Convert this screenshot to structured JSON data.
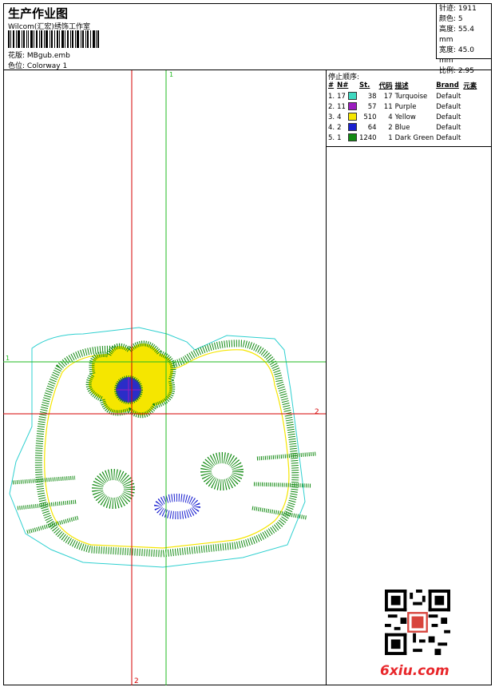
{
  "header": {
    "title": "生产作业图",
    "subtitle": "Wilcom(汇宏)绣饰工作室",
    "design_label": "花版:",
    "design_value": "MBgub.emb",
    "colorway_label": "色位:",
    "colorway_value": "Colorway 1"
  },
  "info": {
    "stitches_label": "针迹:",
    "stitches_value": "1911",
    "colors_label": "颜色:",
    "colors_value": "5",
    "height_label": "高度:",
    "height_value": "55.4 mm",
    "width_label": "宽度:",
    "width_value": "45.0 mm",
    "scale_label": "比例:",
    "scale_value": "2.95"
  },
  "stop_sequence": {
    "title": "停止顺序:",
    "columns": [
      "#",
      "N#",
      "St.",
      "代码",
      "描述",
      "Brand",
      "元素"
    ],
    "rows": [
      {
        "idx": "1.",
        "needle": "17",
        "color": "#3ed8c0",
        "stitches": "38",
        "code": "17",
        "desc": "Turquoise",
        "brand": "Default"
      },
      {
        "idx": "2.",
        "needle": "11",
        "color": "#9b1dbf",
        "stitches": "57",
        "code": "11",
        "desc": "Purple",
        "brand": "Default"
      },
      {
        "idx": "3.",
        "needle": "4",
        "color": "#f5e600",
        "stitches": "510",
        "code": "4",
        "desc": "Yellow",
        "brand": "Default"
      },
      {
        "idx": "4.",
        "needle": "2",
        "color": "#1a20d0",
        "stitches": "64",
        "code": "2",
        "desc": "Blue",
        "brand": "Default"
      },
      {
        "idx": "5.",
        "needle": "1",
        "color": "#128a12",
        "stitches": "1240",
        "code": "1",
        "desc": "Dark Green",
        "brand": "Default"
      }
    ]
  },
  "guides": {
    "v1": "1",
    "h1": "1",
    "h2": "2",
    "v2": "2"
  },
  "watermark": "6xiu.com",
  "colors": {
    "guide_red": "#d40000",
    "guide_green": "#22bb22",
    "outline": "#2fd0d0"
  }
}
